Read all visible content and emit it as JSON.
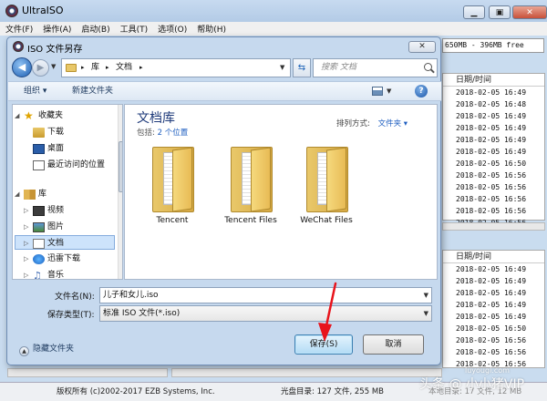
{
  "main_window": {
    "title": "UltraISO",
    "menu": [
      "文件(F)",
      "操作(A)",
      "启动(B)",
      "工具(T)",
      "选项(O)",
      "帮助(H)"
    ],
    "disk_free": "650MB - 396MB free",
    "upper_list": {
      "header": "日期/时间",
      "rows": [
        "2018-02-05 16:49",
        "2018-02-05 16:48",
        "2018-02-05 16:49",
        "2018-02-05 16:49",
        "2018-02-05 16:49",
        "2018-02-05 16:49",
        "2018-02-05 16:50",
        "2018-02-05 16:56",
        "2018-02-05 16:56",
        "2018-02-05 16:56",
        "2018-02-05 16:56",
        "2018-02-05 16:56",
        "2018-02-05 16:57"
      ]
    },
    "lower_list": {
      "header": "日期/时间",
      "rows": [
        "2018-02-05 16:49",
        "2018-02-05 16:49",
        "2018-02-05 16:49",
        "2018-02-05 16:49",
        "2018-02-05 16:49",
        "2018-02-05 16:50",
        "2018-02-05 16:56",
        "2018-02-05 16:56",
        "2018-02-05 16:56"
      ]
    },
    "status": {
      "copyright": "版权所有 (c)2002-2017 EZB Systems, Inc.",
      "disc_dir": "光盘目录: 127 文件, 255 MB",
      "local_dir": "本地目录: 17 文件, 12 MB"
    }
  },
  "dialog": {
    "title": "ISO 文件另存",
    "close_label": "✕",
    "breadcrumb": [
      "库",
      "文档"
    ],
    "search_placeholder": "搜索 文档",
    "toolbar": {
      "organize": "组织 ▾",
      "new_folder": "新建文件夹"
    },
    "nav_tree": {
      "favorites": "收藏夹",
      "downloads": "下载",
      "desktop": "桌面",
      "recent": "最近访问的位置",
      "libraries": "库",
      "videos": "视频",
      "pictures": "图片",
      "documents": "文档",
      "thunder": "迅雷下载",
      "music": "音乐"
    },
    "content": {
      "title": "文档库",
      "includes_label": "包括:",
      "includes_link": "2 个位置",
      "arrange_label": "排列方式:",
      "arrange_value": "文件夹 ▾",
      "folders": [
        "Tencent",
        "Tencent Files",
        "WeChat Files"
      ]
    },
    "filename_label": "文件名(N):",
    "filename_value": "儿子和女儿.iso",
    "filetype_label": "保存类型(T):",
    "filetype_value": "标准 ISO 文件(*.iso)",
    "hide_folders": "隐藏文件夹",
    "save_button": "保存(S)",
    "cancel_button": "取消"
  },
  "watermark": {
    "text": "头条 @ 小小猪VIP",
    "site": "luyougi.com"
  },
  "colors": {
    "dialog_frame": "#c6d9ee",
    "primary_button": "#b2dbf5",
    "annotation_arrow": "#e8141c",
    "link_blue": "#1e5ec0"
  }
}
